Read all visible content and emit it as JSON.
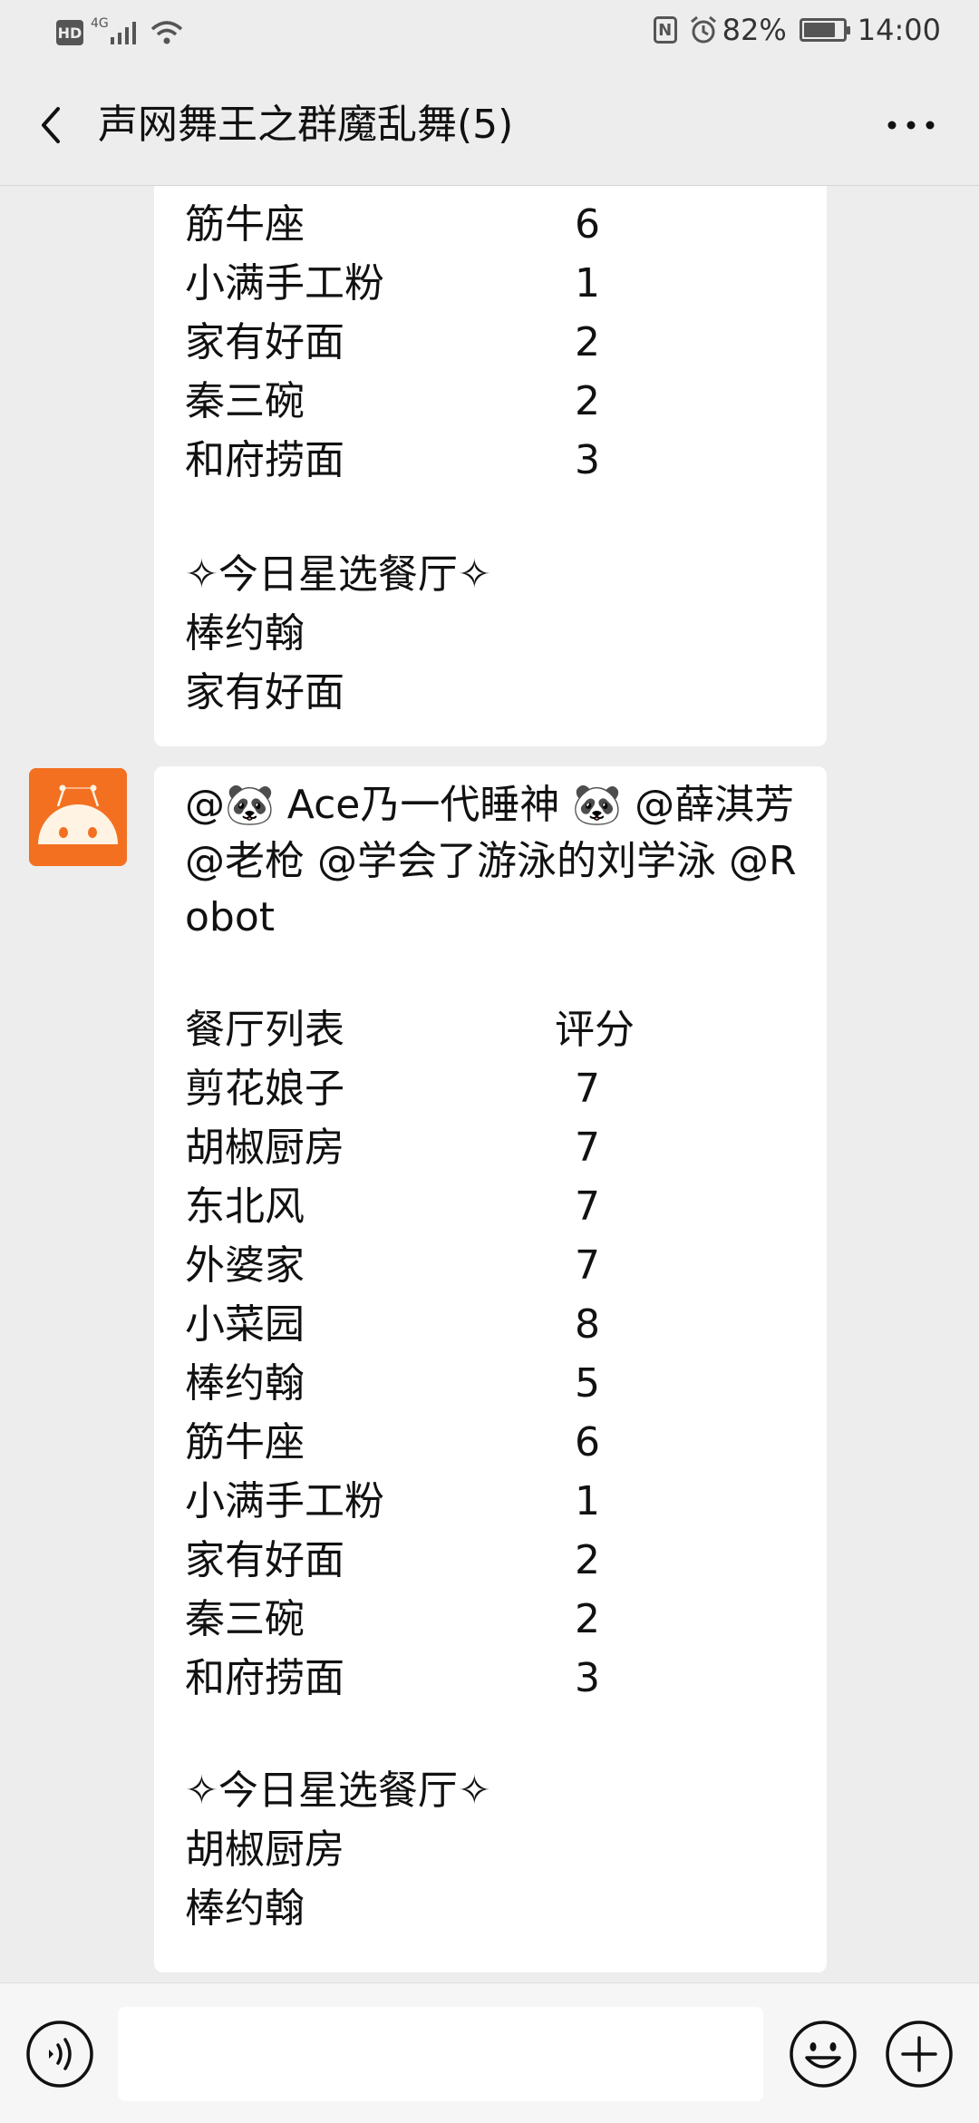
{
  "status_bar": {
    "hd": "HD",
    "network": "4G",
    "nfc": "N",
    "battery": "82%",
    "battery_level": 0.82,
    "time": "14:00"
  },
  "header": {
    "title": "声网舞王之群魔乱舞(5)",
    "back_icon": "chevron-left-icon",
    "more_icon": "more-dots-icon"
  },
  "messages": [
    {
      "rows": [
        {
          "name": "筋牛座",
          "score": "6"
        },
        {
          "name": "小满手工粉",
          "score": "1"
        },
        {
          "name": "家有好面",
          "score": "2"
        },
        {
          "name": "秦三碗",
          "score": "2"
        },
        {
          "name": "和府捞面",
          "score": "3"
        }
      ],
      "star_title": "✧今日星选餐厅✧",
      "star_picks": [
        "棒约翰",
        "家有好面"
      ]
    },
    {
      "sender_avatar": "robot-avatar",
      "mentions": "@🐼 Ace乃一代睡神 🐼 @薛淇芳 @老枪 @学会了游泳的刘学泳 @Robot",
      "list_header": "餐厅列表",
      "score_header": "评分",
      "rows": [
        {
          "name": "剪花娘子",
          "score": "7"
        },
        {
          "name": "胡椒厨房",
          "score": "7"
        },
        {
          "name": "东北风",
          "score": "7"
        },
        {
          "name": "外婆家",
          "score": "7"
        },
        {
          "name": "小菜园",
          "score": "8"
        },
        {
          "name": "棒约翰",
          "score": "5"
        },
        {
          "name": "筋牛座",
          "score": "6"
        },
        {
          "name": "小满手工粉",
          "score": "1"
        },
        {
          "name": "家有好面",
          "score": "2"
        },
        {
          "name": "秦三碗",
          "score": "2"
        },
        {
          "name": "和府捞面",
          "score": "3"
        }
      ],
      "star_title": "✧今日星选餐厅✧",
      "star_picks": [
        "胡椒厨房",
        "棒约翰"
      ]
    }
  ],
  "input_bar": {
    "input_value": "",
    "voice_icon": "voice-icon",
    "emoji_icon": "emoji-icon",
    "plus_icon": "plus-icon"
  },
  "colors": {
    "background": "#ededed",
    "bubble": "#ffffff",
    "avatar": "#f37021"
  }
}
